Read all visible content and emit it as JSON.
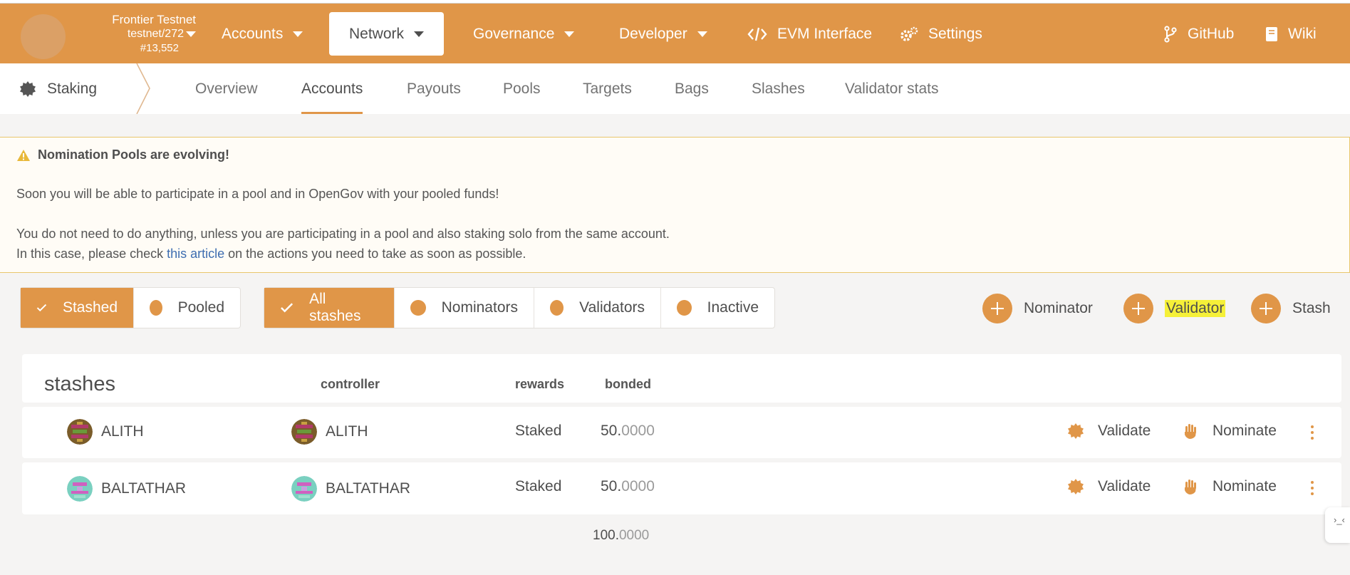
{
  "chain": {
    "name": "Frontier Testnet",
    "spec": "testnet/272",
    "block": "#13,552"
  },
  "nav": {
    "accounts": "Accounts",
    "network": "Network",
    "governance": "Governance",
    "developer": "Developer",
    "evm": "EVM Interface",
    "settings": "Settings",
    "github": "GitHub",
    "wiki": "Wiki"
  },
  "subnav": {
    "title": "Staking",
    "tabs": [
      "Overview",
      "Accounts",
      "Payouts",
      "Pools",
      "Targets",
      "Bags",
      "Slashes",
      "Validator stats"
    ]
  },
  "banner": {
    "title": "Nomination Pools are evolving!",
    "line1": "Soon you will be able to participate in a pool and in OpenGov with your pooled funds!",
    "line2": "You do not need to do anything, unless you are participating in a pool and also staking solo from the same account.",
    "line3_pre": "In this case, please check ",
    "line3_link": "this article",
    "line3_post": " on the actions you need to take as soon as possible."
  },
  "filters": {
    "group1": [
      "Stashed",
      "Pooled"
    ],
    "group2": [
      "All stashes",
      "Nominators",
      "Validators",
      "Inactive"
    ]
  },
  "actions": {
    "nominator": "Nominator",
    "validator": "Validator",
    "stash": "Stash"
  },
  "table": {
    "header": {
      "title": "stashes",
      "controller": "controller",
      "rewards": "rewards",
      "bonded": "bonded"
    },
    "rows": [
      {
        "stash": "ALITH",
        "controller": "ALITH",
        "rewards": "Staked",
        "bonded_int": "50.",
        "bonded_dec": "0000",
        "validate": "Validate",
        "nominate": "Nominate"
      },
      {
        "stash": "BALTATHAR",
        "controller": "BALTATHAR",
        "rewards": "Staked",
        "bonded_int": "50.",
        "bonded_dec": "0000",
        "validate": "Validate",
        "nominate": "Nominate"
      }
    ],
    "total_int": "100.",
    "total_dec": "0000"
  },
  "edge_tab": "›_‹",
  "colors": {
    "accent": "#e09648",
    "highlight": "#f5f038",
    "link": "#3e6db0"
  }
}
